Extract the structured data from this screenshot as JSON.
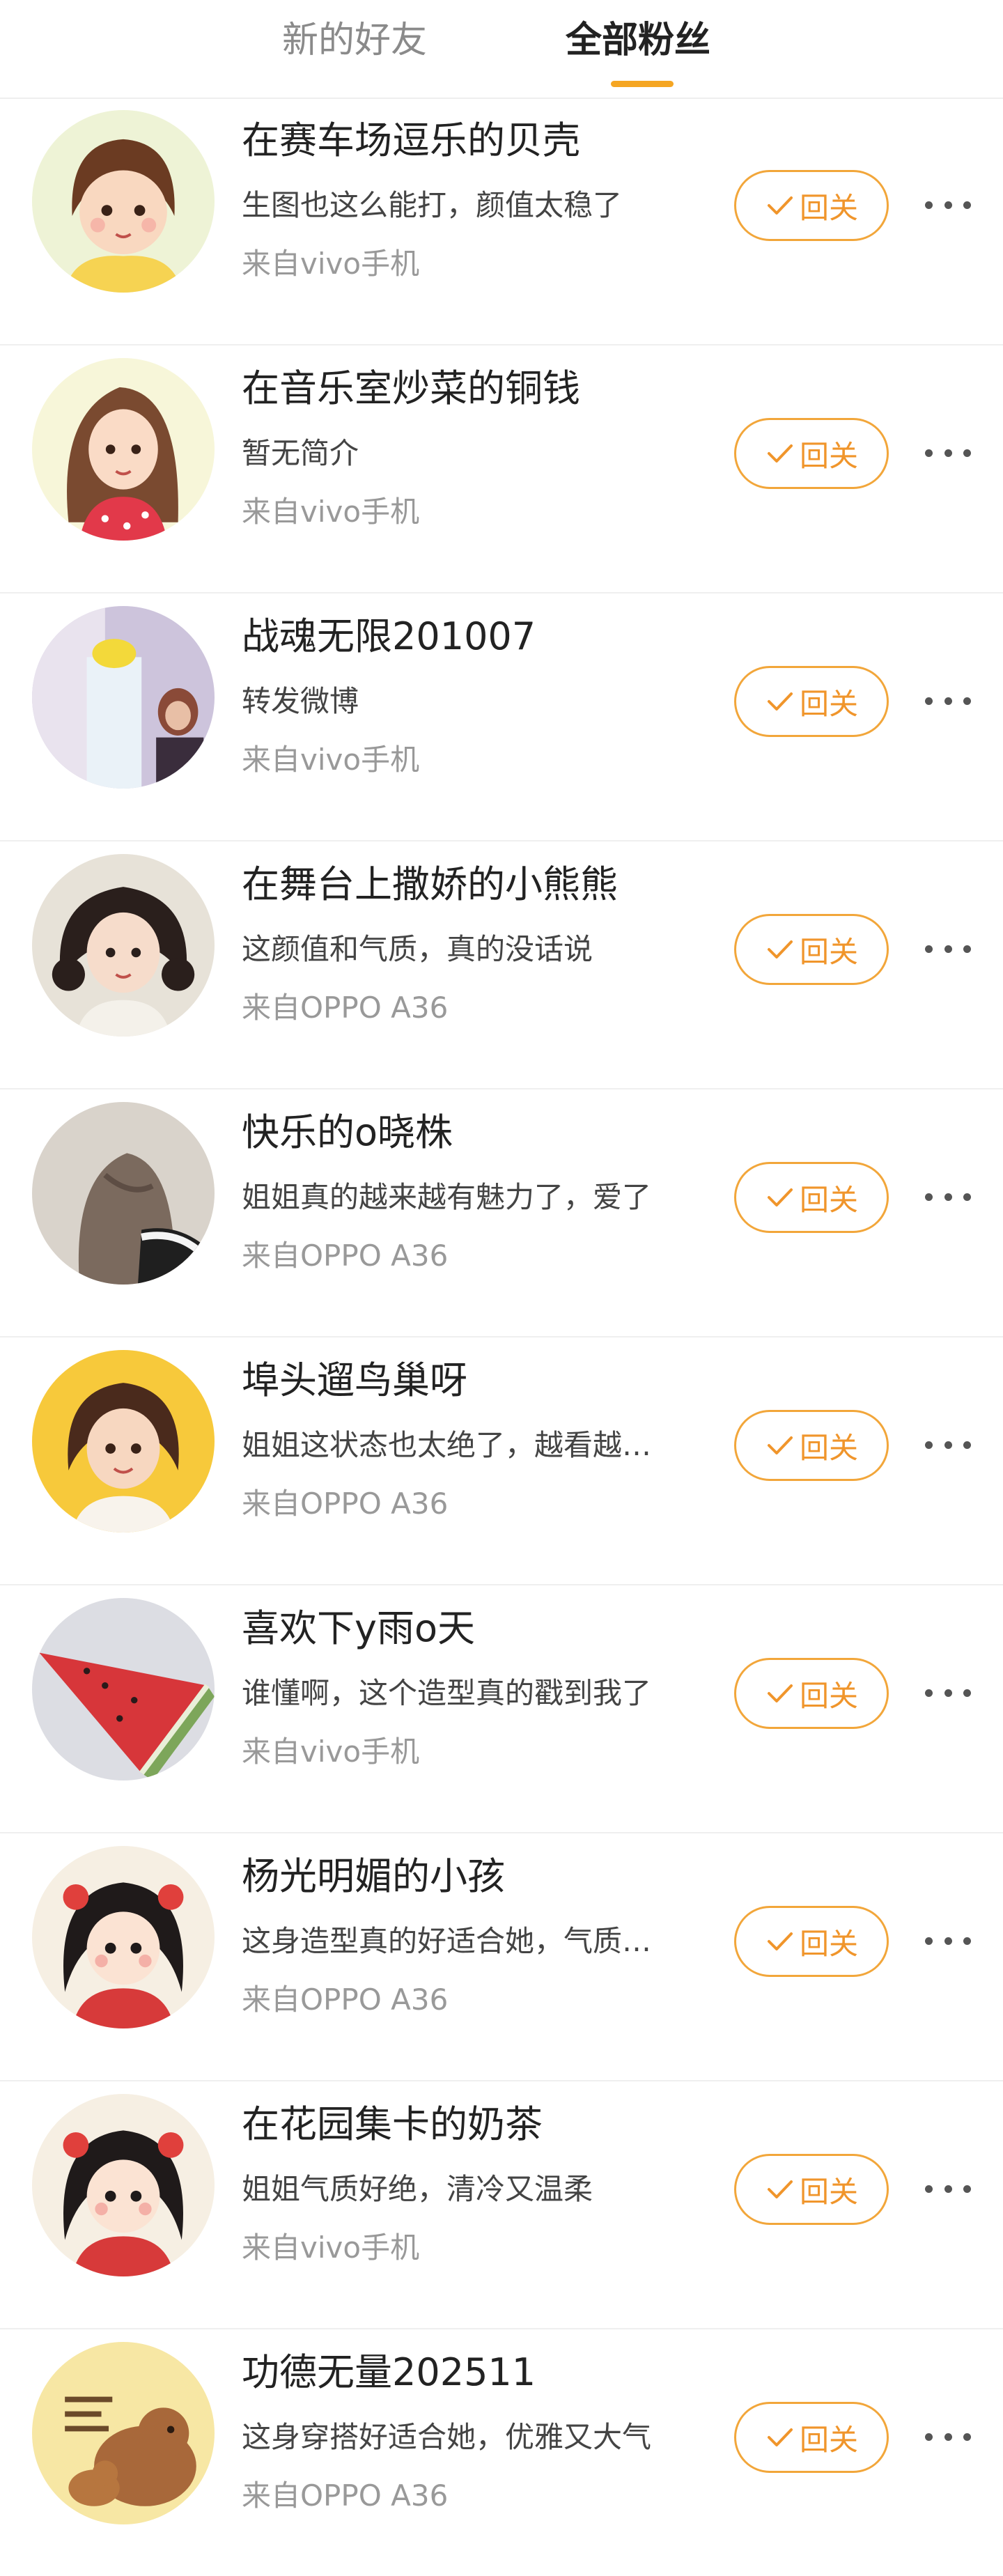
{
  "tabs": [
    {
      "label": "新的好友",
      "active": false
    },
    {
      "label": "全部粉丝",
      "active": true
    }
  ],
  "colors": {
    "accent": "#f5a623",
    "button_text": "#f0952b",
    "source_text": "#999999"
  },
  "follow_back_label": "回关",
  "fans": [
    {
      "name": "在赛车场逗乐的贝壳",
      "desc": "生图也这么能打，颜值太稳了",
      "source": "来自vivo手机",
      "avatar": "cartoon-girl-avatar"
    },
    {
      "name": "在音乐室炒菜的铜钱",
      "desc": "暂无简介",
      "source": "来自vivo手机",
      "avatar": "cartoon-girl-avatar"
    },
    {
      "name": "战魂无限201007",
      "desc": "转发微博",
      "source": "来自vivo手机",
      "avatar": "photo-avatar"
    },
    {
      "name": "在舞台上撒娇的小熊熊",
      "desc": "这颜值和气质，真的没话说",
      "source": "来自OPPO A36",
      "avatar": "cartoon-girl-avatar"
    },
    {
      "name": "快乐的o晓株",
      "desc": "姐姐真的越来越有魅力了，爱了",
      "source": "来自OPPO A36",
      "avatar": "photo-avatar"
    },
    {
      "name": "埠头遛鸟巢呀",
      "desc": "姐姐这状态也太绝了，越看越…",
      "source": "来自OPPO A36",
      "avatar": "cartoon-girl-avatar"
    },
    {
      "name": "喜欢下y雨o天",
      "desc": "谁懂啊，这个造型真的戳到我了",
      "source": "来自vivo手机",
      "avatar": "watermelon-avatar"
    },
    {
      "name": "杨光明媚的小孩",
      "desc": "这身造型真的好适合她，气质…",
      "source": "来自OPPO A36",
      "avatar": "cartoon-girl-avatar"
    },
    {
      "name": "在花园集卡的奶茶",
      "desc": "姐姐气质好绝，清冷又温柔",
      "source": "来自vivo手机",
      "avatar": "cartoon-girl-avatar"
    },
    {
      "name": "功德无量202511",
      "desc": " 这身穿搭好适合她，优雅又大气",
      "source": "来自OPPO A36",
      "avatar": "capybara-avatar"
    }
  ]
}
